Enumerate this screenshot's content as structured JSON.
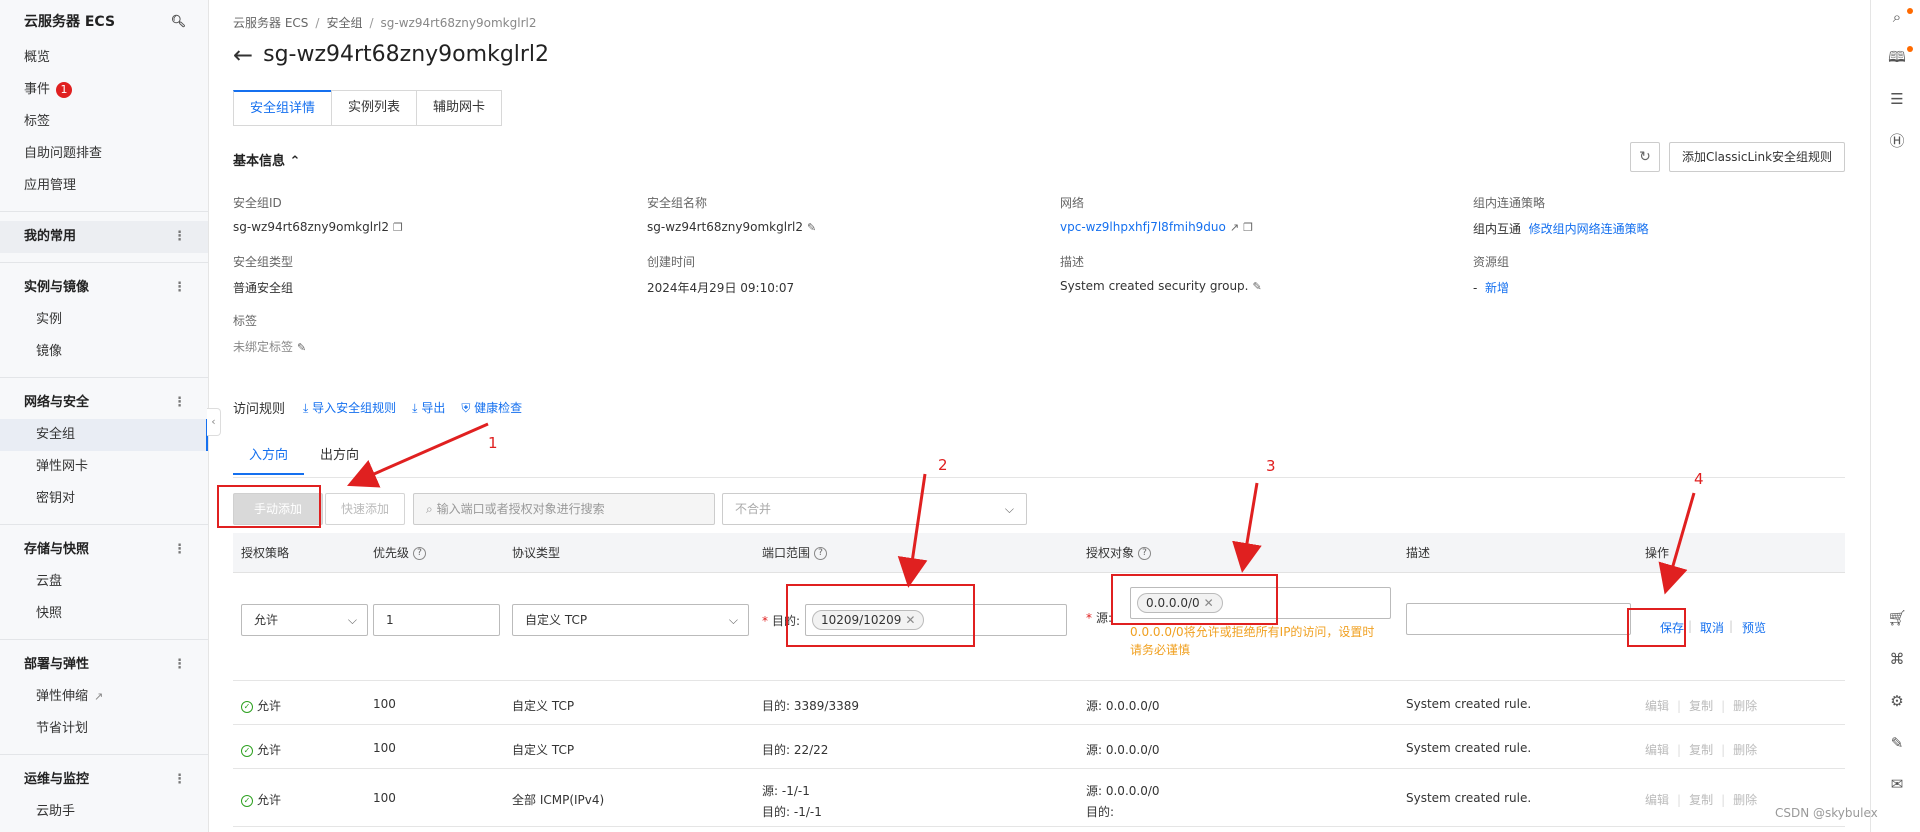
{
  "sidebar": {
    "title": "云服务器 ECS",
    "top_items": [
      {
        "label": "概览"
      },
      {
        "label": "事件",
        "badge": "1"
      },
      {
        "label": "标签"
      },
      {
        "label": "自助问题排查"
      },
      {
        "label": "应用管理"
      }
    ],
    "favorites": "我的常用",
    "groups": [
      {
        "label": "实例与镜像",
        "items": [
          "实例",
          "镜像"
        ]
      },
      {
        "label": "网络与安全",
        "items": [
          "安全组",
          "弹性网卡",
          "密钥对"
        ]
      },
      {
        "label": "存储与快照",
        "items": [
          "云盘",
          "快照"
        ]
      },
      {
        "label": "部署与弹性",
        "items": [
          "弹性伸缩",
          "节省计划"
        ]
      },
      {
        "label": "运维与监控",
        "items": [
          "云助手"
        ]
      }
    ]
  },
  "breadcrumb": [
    "云服务器 ECS",
    "安全组",
    "sg-wz94rt68zny9omkglrl2"
  ],
  "page_title": "sg-wz94rt68zny9omkglrl2",
  "tabs": [
    "安全组详情",
    "实例列表",
    "辅助网卡"
  ],
  "basic_info": {
    "title": "基本信息",
    "classic_link_btn": "添加ClassicLink安全组规则",
    "fields": {
      "sg_id_label": "安全组ID",
      "sg_id": "sg-wz94rt68zny9omkglrl2",
      "sg_name_label": "安全组名称",
      "sg_name": "sg-wz94rt68zny9omkglrl2",
      "network_label": "网络",
      "network": "vpc-wz9lhpxhfj7l8fmih9duo",
      "policy_label": "组内连通策略",
      "policy": "组内互通",
      "policy_link": "修改组内网络连通策略",
      "type_label": "安全组类型",
      "type": "普通安全组",
      "created_label": "创建时间",
      "created": "2024年4月29日 09:10:07",
      "desc_label": "描述",
      "desc": "System created security group.",
      "rg_label": "资源组",
      "rg_dash": "-",
      "rg_link": "新增",
      "tags_label": "标签",
      "tags": "未绑定标签"
    }
  },
  "rules": {
    "lead": "访问规则",
    "actions": [
      "导入安全组规则",
      "导出",
      "健康检查"
    ],
    "direction_tabs": [
      "入方向",
      "出方向"
    ],
    "manual_add": "手动添加",
    "quick_add": "快速添加",
    "search_placeholder": "输入端口或者授权对象进行搜索",
    "merge_select": "不合并",
    "columns": [
      "授权策略",
      "优先级",
      "协议类型",
      "端口范围",
      "授权对象",
      "描述",
      "操作"
    ],
    "form": {
      "policy": "允许",
      "priority": "1",
      "protocol": "自定义 TCP",
      "dest_label": "目的:",
      "port_tag": "10209/10209",
      "source_label": "源:",
      "source_tag": "0.0.0.0/0",
      "warning": "0.0.0.0/0将允许或拒绝所有IP的访问，设置时请务必谨慎",
      "save": "保存",
      "cancel": "取消",
      "preview": "预览"
    },
    "rows": [
      {
        "policy": "允许",
        "priority": "100",
        "protocol": "自定义 TCP",
        "port": "目的: 3389/3389",
        "port2": "",
        "source": "源: 0.0.0.0/0",
        "source2": "",
        "desc": "System created rule."
      },
      {
        "policy": "允许",
        "priority": "100",
        "protocol": "自定义 TCP",
        "port": "目的: 22/22",
        "port2": "",
        "source": "源: 0.0.0.0/0",
        "source2": "",
        "desc": "System created rule."
      },
      {
        "policy": "允许",
        "priority": "100",
        "protocol": "全部 ICMP(IPv4)",
        "port": "源: -1/-1",
        "port2": "目的: -1/-1",
        "source": "源: 0.0.0.0/0",
        "source2": "目的:",
        "desc": "System created rule."
      }
    ],
    "row_ops": [
      "编辑",
      "复制",
      "删除"
    ]
  },
  "annotations": [
    "1",
    "2",
    "3",
    "4"
  ],
  "watermark": "CSDN @skybulex",
  "colors": {
    "accent": "#1570ef",
    "annotation": "#e02020",
    "warning": "#f0a020",
    "success": "#2ea121"
  },
  "icons": [
    "search-icon",
    "back-arrow-icon",
    "refresh-icon",
    "copy-icon",
    "edit-icon",
    "external-link-icon",
    "chevron-down-icon",
    "help-icon",
    "check-circle-icon",
    "cart-icon",
    "settings-icon"
  ]
}
